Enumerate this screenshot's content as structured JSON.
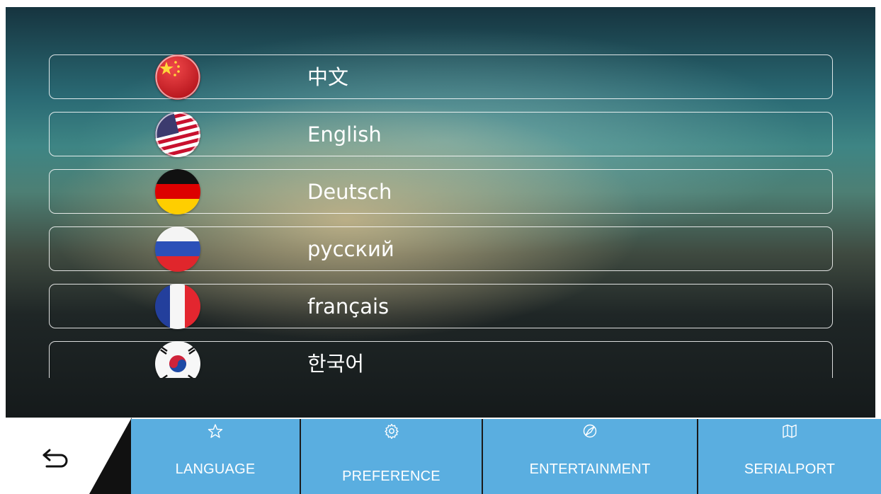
{
  "languages": [
    {
      "label": "中文",
      "flag": "china-flag-icon"
    },
    {
      "label": "English",
      "flag": "usa-flag-icon"
    },
    {
      "label": "Deutsch",
      "flag": "germany-flag-icon"
    },
    {
      "label": "русский",
      "flag": "russia-flag-icon"
    },
    {
      "label": "français",
      "flag": "france-flag-icon"
    },
    {
      "label": "한국어",
      "flag": "korea-flag-icon"
    }
  ],
  "nav": {
    "back_icon": "back-arrow-icon",
    "tabs": [
      {
        "label": "LANGUAGE",
        "icon": "star-icon"
      },
      {
        "label": "PREFERENCE",
        "icon": "gear-icon"
      },
      {
        "label": "ENTERTAINMENT",
        "icon": "compass-icon"
      },
      {
        "label": "SERIALPORT",
        "icon": "map-icon"
      }
    ]
  },
  "colors": {
    "tab_bg": "#5aaee0",
    "row_border": "#ffffff"
  }
}
